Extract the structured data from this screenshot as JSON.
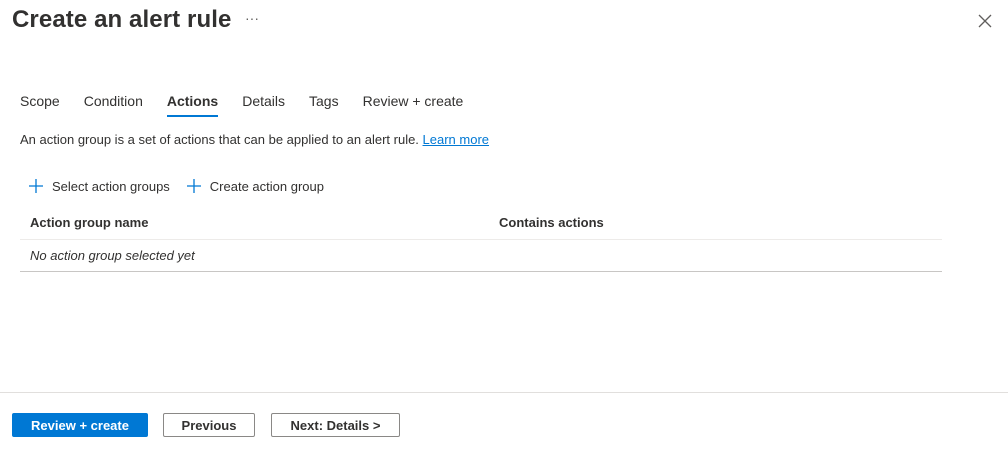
{
  "header": {
    "title": "Create an alert rule",
    "more_label": "···",
    "close_icon": "close-icon"
  },
  "tabs": [
    {
      "label": "Scope",
      "active": false
    },
    {
      "label": "Condition",
      "active": false
    },
    {
      "label": "Actions",
      "active": true
    },
    {
      "label": "Details",
      "active": false
    },
    {
      "label": "Tags",
      "active": false
    },
    {
      "label": "Review + create",
      "active": false
    }
  ],
  "description": {
    "text": "An action group is a set of actions that can be applied to an alert rule. ",
    "link": "Learn more"
  },
  "commands": {
    "select_label": "Select action groups",
    "create_label": "Create action group",
    "icon": "plus-icon"
  },
  "table": {
    "columns": [
      "Action group name",
      "Contains actions"
    ],
    "empty_text": "No action group selected yet"
  },
  "footer": {
    "review_label": "Review + create",
    "previous_label": "Previous",
    "next_label": "Next: Details >"
  },
  "colors": {
    "accent": "#0078d4",
    "text": "#323130",
    "border": "#8a8886"
  }
}
